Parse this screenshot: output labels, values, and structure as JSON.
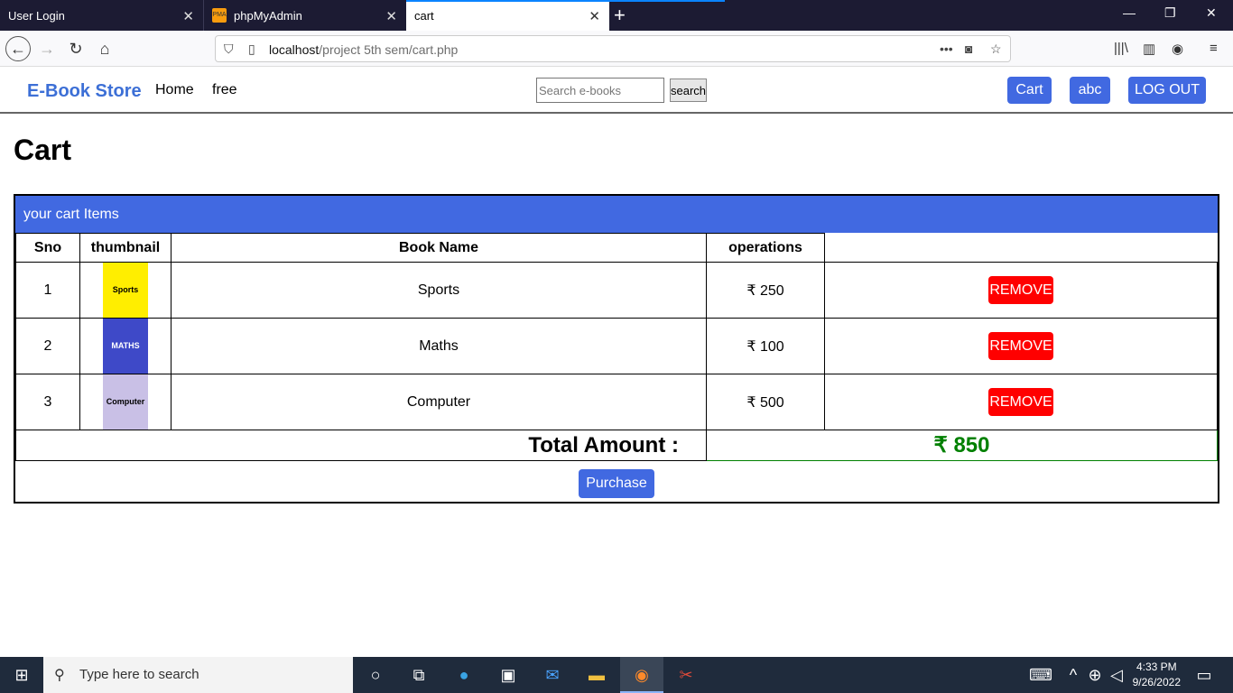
{
  "browser": {
    "tabs": [
      {
        "label": "User Login"
      },
      {
        "label": "phpMyAdmin"
      },
      {
        "label": "cart"
      }
    ],
    "url_prefix": "localhost",
    "url_path": "/project 5th sem/cart.php"
  },
  "site": {
    "brand": "E-Book Store",
    "nav": {
      "home": "Home",
      "free": "free"
    },
    "search": {
      "placeholder": "Search e-books",
      "button": "search"
    },
    "buttons": {
      "cart": "Cart",
      "user": "abc",
      "logout": "LOG OUT"
    }
  },
  "cart": {
    "title": "Cart",
    "panel_heading": "your cart Items",
    "columns": [
      "Sno",
      "thumbnail",
      "Book Name",
      "operations"
    ],
    "rows": [
      {
        "sno": "1",
        "thumb_text": "Sports",
        "thumb_color": "#ffee00",
        "name": "Sports",
        "price": "₹ 250",
        "action": "REMOVE"
      },
      {
        "sno": "2",
        "thumb_text": "MATHS",
        "thumb_color": "#3e49c8",
        "name": "Maths",
        "price": "₹ 100",
        "action": "REMOVE"
      },
      {
        "sno": "3",
        "thumb_text": "Computer",
        "thumb_color": "#c9c0e6",
        "name": "Computer",
        "price": "₹ 500",
        "action": "REMOVE"
      }
    ],
    "total_label": "Total Amount :",
    "total_value": "₹ 850",
    "purchase": "Purchase"
  },
  "taskbar": {
    "search_placeholder": "Type here to search",
    "time": "4:33 PM",
    "date": "9/26/2022"
  },
  "colors": {
    "accent": "#4169e1",
    "danger": "#ff0000",
    "total": "#008000"
  }
}
